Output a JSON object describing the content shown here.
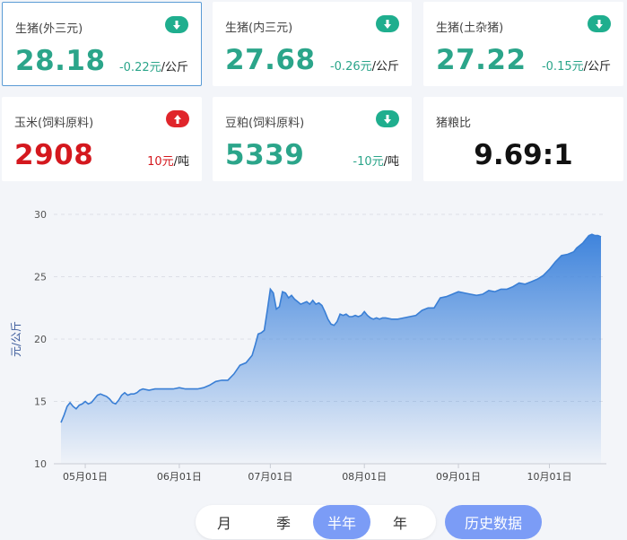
{
  "cards": [
    {
      "title": "生猪(外三元)",
      "price": "28.18",
      "change": "-0.22元",
      "unit": "/公斤",
      "direction": "down"
    },
    {
      "title": "生猪(内三元)",
      "price": "27.68",
      "change": "-0.26元",
      "unit": "/公斤",
      "direction": "down"
    },
    {
      "title": "生猪(土杂猪)",
      "price": "27.22",
      "change": "-0.15元",
      "unit": "/公斤",
      "direction": "down"
    },
    {
      "title": "玉米(饲料原料)",
      "price": "2908",
      "change": "10元",
      "unit": "/吨",
      "direction": "up"
    },
    {
      "title": "豆粕(饲料原料)",
      "price": "5339",
      "change": "-10元",
      "unit": "/吨",
      "direction": "down"
    },
    {
      "title": "猪粮比",
      "ratio": "9.69:1"
    }
  ],
  "colors": {
    "down": "#2ba58a",
    "up": "#d4181e",
    "accent": "#7b9cf6",
    "area_top": "#3f84dc",
    "line": "#3a7fd5"
  },
  "icons": {
    "down": "arrow-down-circle-icon",
    "up": "arrow-up-circle-icon"
  },
  "controls": {
    "periods": [
      "月",
      "季",
      "半年",
      "年"
    ],
    "selected": "半年",
    "history_label": "历史数据"
  },
  "chart_data": {
    "type": "area",
    "ylabel": "元/公斤",
    "xlabel": "",
    "ylim": [
      10,
      30
    ],
    "yticks": [
      10,
      15,
      20,
      25,
      30
    ],
    "grid": "horizontal dashed",
    "xticks": [
      {
        "label": "05月01日",
        "day": 1
      },
      {
        "label": "06月01日",
        "day": 32
      },
      {
        "label": "07月01日",
        "day": 62
      },
      {
        "label": "08月01日",
        "day": 93
      },
      {
        "label": "09月01日",
        "day": 124
      },
      {
        "label": "10月01日",
        "day": 154
      }
    ],
    "series": [
      {
        "x": [
          -7,
          -6,
          -5,
          -4,
          -3,
          -2,
          -1,
          0,
          1,
          2,
          3,
          4,
          5,
          6,
          7,
          8,
          9,
          10,
          11,
          12,
          13,
          14,
          15,
          16,
          17,
          18,
          19,
          20,
          22,
          24,
          26,
          28,
          30,
          32,
          34,
          36,
          38,
          40,
          42,
          44,
          46,
          48,
          50,
          52,
          54,
          56,
          57,
          58,
          59,
          60,
          61,
          62,
          63,
          64,
          65,
          66,
          67,
          68,
          69,
          70,
          71,
          72,
          73,
          74,
          75,
          76,
          77,
          78,
          79,
          80,
          81,
          82,
          83,
          84,
          85,
          86,
          87,
          88,
          89,
          90,
          91,
          92,
          93,
          94,
          95,
          96,
          97,
          98,
          99,
          100,
          102,
          104,
          106,
          108,
          110,
          112,
          114,
          116,
          118,
          120,
          122,
          124,
          126,
          128,
          130,
          132,
          134,
          136,
          138,
          140,
          142,
          144,
          146,
          148,
          150,
          152,
          154,
          156,
          158,
          160,
          162,
          163,
          164,
          165,
          166,
          167,
          168,
          169,
          170,
          171
        ],
        "values": [
          13.3,
          13.9,
          14.6,
          14.9,
          14.6,
          14.4,
          14.7,
          14.8,
          15.0,
          14.8,
          14.9,
          15.2,
          15.5,
          15.6,
          15.5,
          15.4,
          15.2,
          14.9,
          14.8,
          15.1,
          15.5,
          15.7,
          15.5,
          15.6,
          15.6,
          15.7,
          15.9,
          16.0,
          15.9,
          16.0,
          16.0,
          16.0,
          16.0,
          16.1,
          16.0,
          16.0,
          16.0,
          16.1,
          16.3,
          16.6,
          16.7,
          16.7,
          17.2,
          17.9,
          18.1,
          18.7,
          19.5,
          20.4,
          20.5,
          20.7,
          22.3,
          24.0,
          23.7,
          22.4,
          22.6,
          23.8,
          23.7,
          23.3,
          23.5,
          23.2,
          23.0,
          22.8,
          22.9,
          23.0,
          22.8,
          23.1,
          22.8,
          22.9,
          22.7,
          22.2,
          21.6,
          21.2,
          21.1,
          21.4,
          22.0,
          21.9,
          22.0,
          21.8,
          21.8,
          21.9,
          21.8,
          21.9,
          22.2,
          21.9,
          21.7,
          21.6,
          21.7,
          21.6,
          21.7,
          21.7,
          21.6,
          21.6,
          21.7,
          21.8,
          21.9,
          22.3,
          22.5,
          22.5,
          23.3,
          23.4,
          23.6,
          23.8,
          23.7,
          23.6,
          23.5,
          23.6,
          23.9,
          23.8,
          24.0,
          24.0,
          24.2,
          24.5,
          24.4,
          24.6,
          24.8,
          25.1,
          25.6,
          26.2,
          26.7,
          26.8,
          27.0,
          27.3,
          27.5,
          27.7,
          28.0,
          28.3,
          28.4,
          28.3,
          28.3,
          28.2
        ]
      }
    ]
  }
}
